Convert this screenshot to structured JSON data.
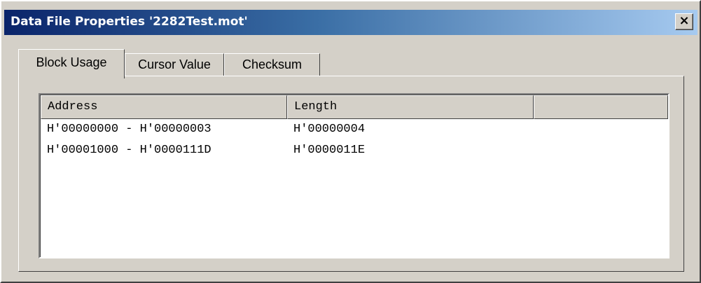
{
  "window": {
    "title": "Data File Properties '2282Test.mot'",
    "close_label": "×"
  },
  "tabs": [
    {
      "label": "Block Usage",
      "active": true
    },
    {
      "label": "Cursor Value",
      "active": false
    },
    {
      "label": "Checksum",
      "active": false
    }
  ],
  "table": {
    "columns": [
      "Address",
      "Length",
      ""
    ],
    "rows": [
      {
        "address": "H'00000000 - H'00000003",
        "length": "H'00000004"
      },
      {
        "address": "H'00001000 - H'0000111D",
        "length": "H'0000011E"
      }
    ]
  },
  "colors": {
    "title_gradient_start": "#0a246a",
    "title_gradient_end": "#a6caf0",
    "face": "#d4d0c8"
  }
}
